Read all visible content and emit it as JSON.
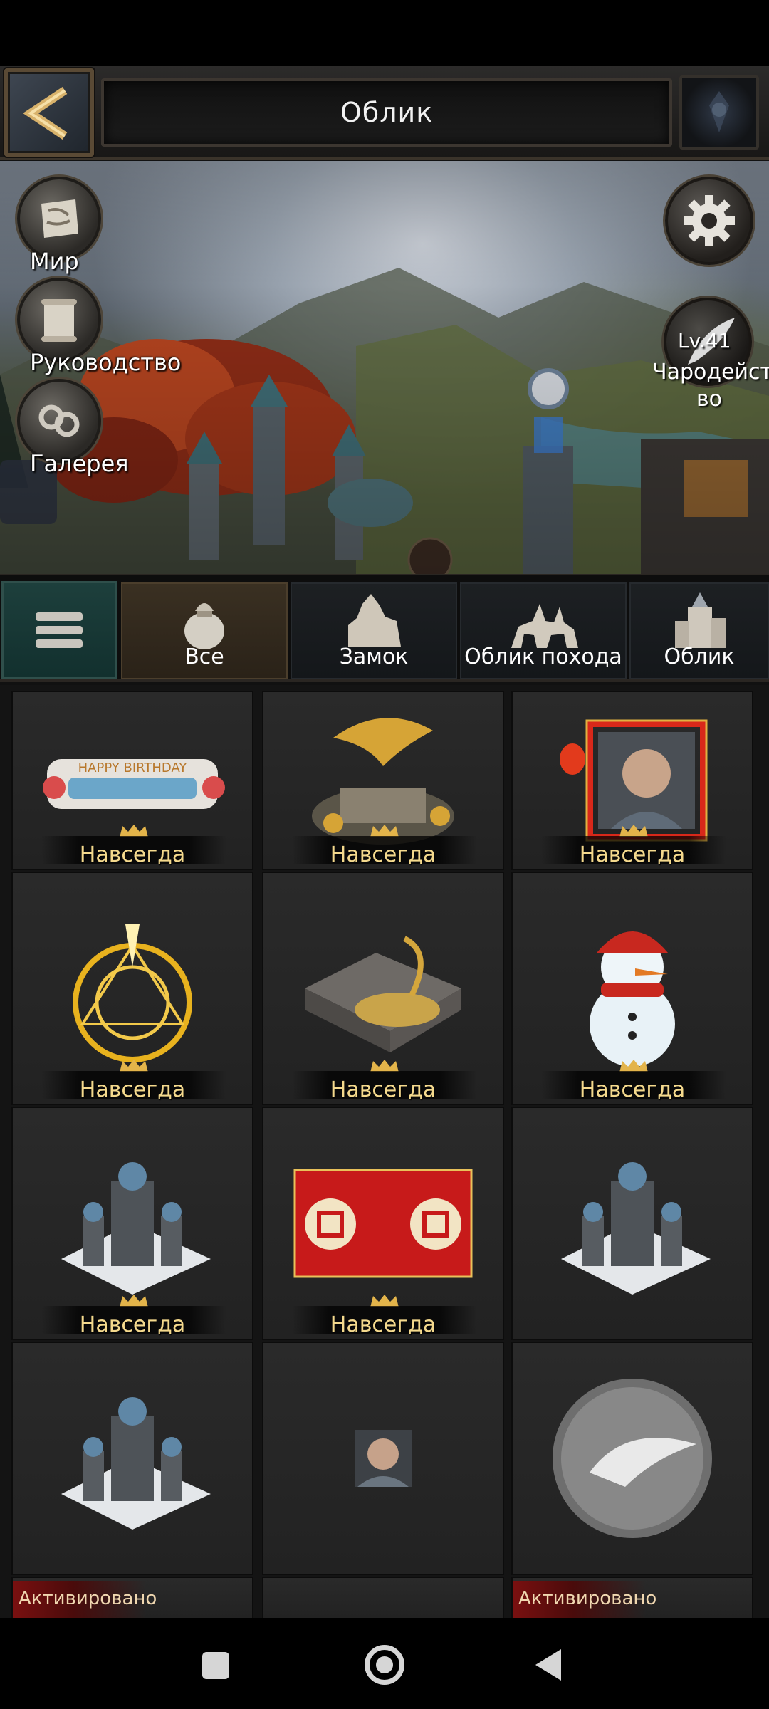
{
  "header": {
    "title": "Облик"
  },
  "scene": {
    "side_buttons": [
      {
        "label": "Мир",
        "icon": "world-map-scroll-icon"
      },
      {
        "label": "Руководство",
        "icon": "guide-scroll-icon"
      },
      {
        "label": "Галерея",
        "icon": "gallery-shackles-icon"
      }
    ],
    "sorcery": {
      "level": "Lv.41",
      "label": "Чародейст\nво"
    }
  },
  "tabs": [
    {
      "label": "Все",
      "icon": "bag-icon",
      "active": true
    },
    {
      "label": "Замок",
      "icon": "castle-icon",
      "active": false
    },
    {
      "label": "Облик похода",
      "icon": "cavalry-icon",
      "active": false
    },
    {
      "label": "Облик",
      "icon": "building-icon",
      "active": false
    }
  ],
  "grid": {
    "items": [
      {
        "art": "birthday-banner",
        "status": "Навсегда"
      },
      {
        "art": "golden-dragon-castle",
        "status": "Навсегда"
      },
      {
        "art": "lantern-portrait-frame",
        "status": "Навсегда"
      },
      {
        "art": "golden-magic-circle",
        "status": "Навсегда"
      },
      {
        "art": "dragon-fortress",
        "status": "Навсегда"
      },
      {
        "art": "snowman",
        "status": "Навсегда"
      },
      {
        "art": "winter-castle",
        "status": "Навсегда"
      },
      {
        "art": "red-chinese-banner",
        "status": "Навсегда"
      },
      {
        "art": "winter-castle",
        "status": ""
      },
      {
        "art": "winter-castle",
        "status": ""
      },
      {
        "art": "hero-portrait",
        "status": ""
      },
      {
        "art": "wing-emblem",
        "status": ""
      }
    ],
    "activated_label": "Активировано"
  },
  "colors": {
    "gold_text": "#f4d98d",
    "tab_active": "#3a3022",
    "menu_teal": "#1d3f3c"
  }
}
